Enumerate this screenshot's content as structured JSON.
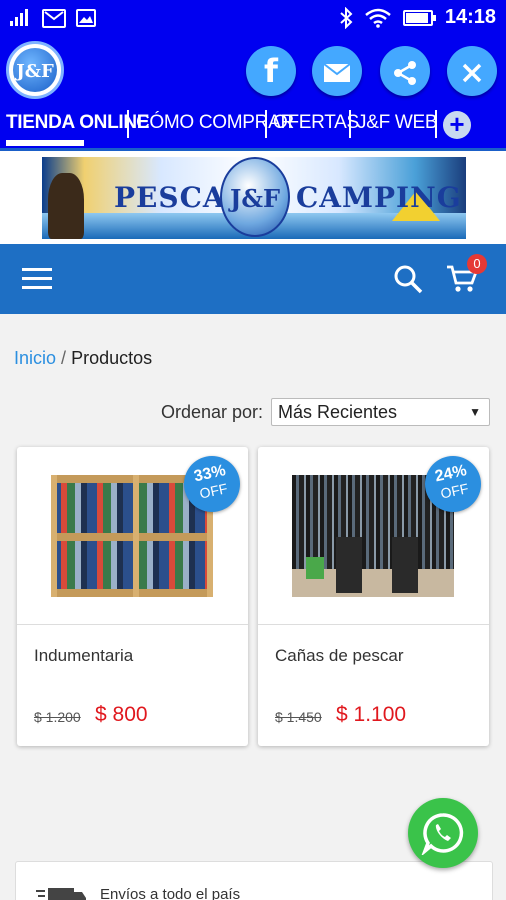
{
  "status_bar": {
    "time": "14:18"
  },
  "header": {
    "logo_text": "J&F",
    "buttons": {
      "facebook": "f"
    }
  },
  "nav": {
    "tabs": [
      {
        "label": "TIENDA ONLINE"
      },
      {
        "label": "CÓMO COMPRAR"
      },
      {
        "label": "OFERTAS"
      },
      {
        "label": "J&F WEB"
      }
    ],
    "more": "+"
  },
  "banner": {
    "left_text": "PESCA",
    "right_text": "CAMPING",
    "logo_text": "J&F"
  },
  "toolbar": {
    "cart_count": "0"
  },
  "breadcrumb": {
    "home": "Inicio",
    "separator": "/",
    "current": "Productos"
  },
  "sort": {
    "label": "Ordenar por:",
    "selected": "Más Recientes",
    "arrow": "▼"
  },
  "products": [
    {
      "name": "Indumentaria",
      "discount": "33%",
      "off": "OFF",
      "old_price": "$ 1.200",
      "price": "$ 800"
    },
    {
      "name": "Cañas de pescar",
      "discount": "24%",
      "off": "OFF",
      "old_price": "$ 1.450",
      "price": "$ 1.100"
    }
  ],
  "shipping": {
    "text": "Envíos a todo el país"
  },
  "colors": {
    "app_blue": "#0000f0",
    "toolbar_blue": "#1e6fc4",
    "accent": "#2b8fe0",
    "price_red": "#e0181e",
    "whatsapp_green": "#3ac34a"
  },
  "icons": [
    "signal-icon",
    "mail-icon",
    "image-icon",
    "bluetooth-icon",
    "wifi-icon",
    "battery-icon",
    "facebook-icon",
    "email-icon",
    "share-icon",
    "close-icon",
    "plus-icon",
    "menu-icon",
    "search-icon",
    "cart-icon",
    "whatsapp-icon",
    "truck-icon"
  ]
}
